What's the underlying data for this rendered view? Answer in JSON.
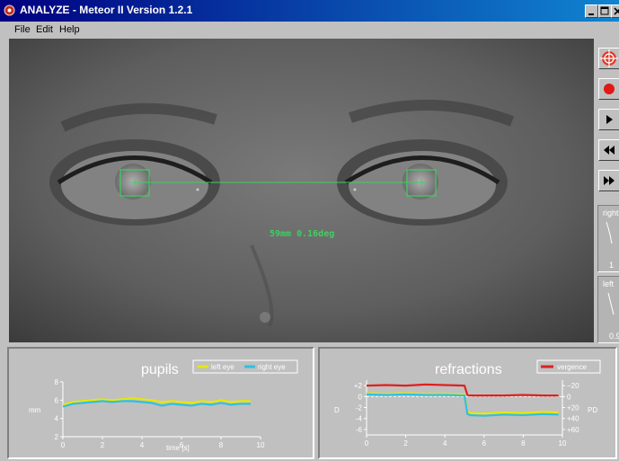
{
  "window": {
    "title": "ANALYZE - Meteor II  Version 1.2.1",
    "controls": [
      "minimize",
      "maximize",
      "close"
    ]
  },
  "menu": {
    "items": [
      "File",
      "Edit",
      "Help"
    ]
  },
  "video": {
    "measurement": "59mm 0.16deg",
    "colors": {
      "tracking": "#3dd060"
    }
  },
  "sidebar": {
    "buttons": [
      {
        "name": "target-icon"
      },
      {
        "name": "record-icon"
      },
      {
        "name": "play-icon"
      },
      {
        "name": "rewind-icon"
      },
      {
        "name": "fast-forward-icon"
      }
    ],
    "mini_panels": [
      {
        "label": "right",
        "value": "1"
      },
      {
        "label": "left",
        "value": "0.9"
      }
    ]
  },
  "chart_data": [
    {
      "type": "line",
      "title": "pupils",
      "xlabel": "time [s]",
      "ylabel": "mm",
      "xlim": [
        0,
        10
      ],
      "ylim": [
        2,
        8
      ],
      "x_ticks": [
        0,
        2,
        4,
        6,
        8,
        10
      ],
      "y_ticks": [
        2,
        4,
        6,
        8
      ],
      "grid": false,
      "legend_position": "top-right",
      "series": [
        {
          "name": "left eye",
          "color": "#e8e800",
          "x": [
            0,
            0.5,
            1,
            1.5,
            2,
            2.5,
            3,
            3.5,
            4,
            4.5,
            5,
            5.5,
            6,
            6.5,
            7,
            7.5,
            8,
            8.5,
            9,
            9.5
          ],
          "y": [
            5.5,
            5.8,
            5.9,
            6.0,
            6.1,
            6.0,
            6.1,
            6.2,
            6.1,
            6.0,
            5.8,
            5.9,
            5.8,
            5.7,
            5.9,
            5.8,
            6.0,
            5.8,
            5.9,
            5.9
          ]
        },
        {
          "name": "right eye",
          "color": "#30c0e0",
          "x": [
            0,
            0.5,
            1,
            1.5,
            2,
            2.5,
            3,
            3.5,
            4,
            4.5,
            5,
            5.5,
            6,
            6.5,
            7,
            7.5,
            8,
            8.5,
            9,
            9.5
          ],
          "y": [
            5.3,
            5.6,
            5.7,
            5.8,
            5.9,
            5.8,
            5.9,
            5.9,
            5.8,
            5.7,
            5.4,
            5.6,
            5.5,
            5.4,
            5.6,
            5.5,
            5.7,
            5.5,
            5.6,
            5.6
          ]
        }
      ]
    },
    {
      "type": "line",
      "title": "refractions",
      "xlabel": "",
      "ylabel": "D",
      "y2label": "PD",
      "xlim": [
        0,
        10
      ],
      "ylim": [
        -7,
        3
      ],
      "x_ticks": [
        0,
        2,
        4,
        6,
        8,
        10
      ],
      "y_ticks": [
        -6,
        -4,
        -2,
        0,
        2
      ],
      "y_tick_labels": [
        "-6",
        "-4",
        "-2",
        "0",
        "+2"
      ],
      "y2_tick_labels": [
        "+60",
        "+40",
        "+20",
        "0",
        "−20"
      ],
      "grid": false,
      "legend_position": "top-right",
      "series": [
        {
          "name": "",
          "color": "#e8e800",
          "x": [
            0,
            1,
            2,
            3,
            4,
            5,
            5.15,
            5.3,
            6,
            7,
            8,
            9,
            9.8
          ],
          "y": [
            0.6,
            0.5,
            0.6,
            0.5,
            0.5,
            0.4,
            -2.8,
            -3.0,
            -3.1,
            -2.9,
            -3.0,
            -2.8,
            -2.9
          ]
        },
        {
          "name": "",
          "color": "#30c0e0",
          "x": [
            0,
            1,
            2,
            3,
            4,
            5,
            5.15,
            5.3,
            6,
            7,
            8,
            9,
            9.8
          ],
          "y": [
            0.4,
            0.3,
            0.4,
            0.3,
            0.3,
            0.2,
            -3.2,
            -3.4,
            -3.5,
            -3.3,
            -3.4,
            -3.2,
            -3.3
          ]
        },
        {
          "name": "vergence",
          "color": "#e02020",
          "x": [
            0,
            1,
            2,
            3,
            4,
            5,
            5.15,
            5.3,
            6,
            7,
            8,
            9,
            9.8
          ],
          "y": [
            2.0,
            2.1,
            2.0,
            2.2,
            2.1,
            2.0,
            0.3,
            0.2,
            0.2,
            0.2,
            0.3,
            0.2,
            0.2
          ]
        }
      ]
    }
  ]
}
